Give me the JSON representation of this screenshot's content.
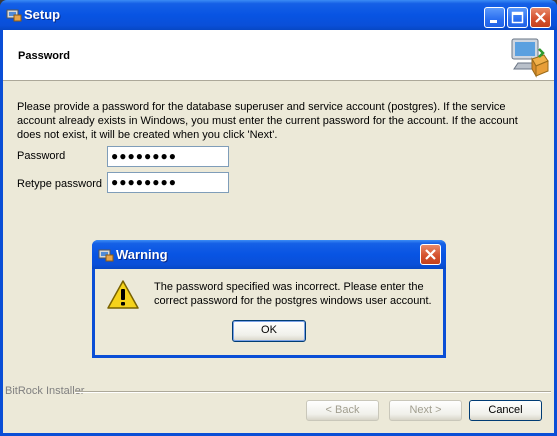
{
  "window": {
    "title": "Setup",
    "icon": "setup-app-icon",
    "controls": {
      "minimize": "minimize-icon",
      "maximize": "maximize-icon",
      "close": "close-icon"
    }
  },
  "header": {
    "title": "Password",
    "icon": "computer-install-icon"
  },
  "body": {
    "description": "Please provide a password for the database superuser and service account (postgres). If the service account already exists in Windows, you must enter the current password for the account. If the account does not exist, it will be created when you click 'Next'.",
    "password_label": "Password",
    "password_value": "●●●●●●●●",
    "retype_label": "Retype password",
    "retype_value": "●●●●●●●●"
  },
  "footer": {
    "brand": "BitRock Installer",
    "back_label": "< Back",
    "next_label": "Next >",
    "cancel_label": "Cancel"
  },
  "dialog": {
    "title": "Warning",
    "message": "The password specified was incorrect. Please enter the correct password for the postgres windows user account.",
    "ok_label": "OK",
    "icon": "warning-icon"
  },
  "colors": {
    "titlebar": "#0854e3",
    "client": "#ece9d8",
    "close_button": "#d5532f",
    "warning_yellow": "#f5d21b"
  }
}
